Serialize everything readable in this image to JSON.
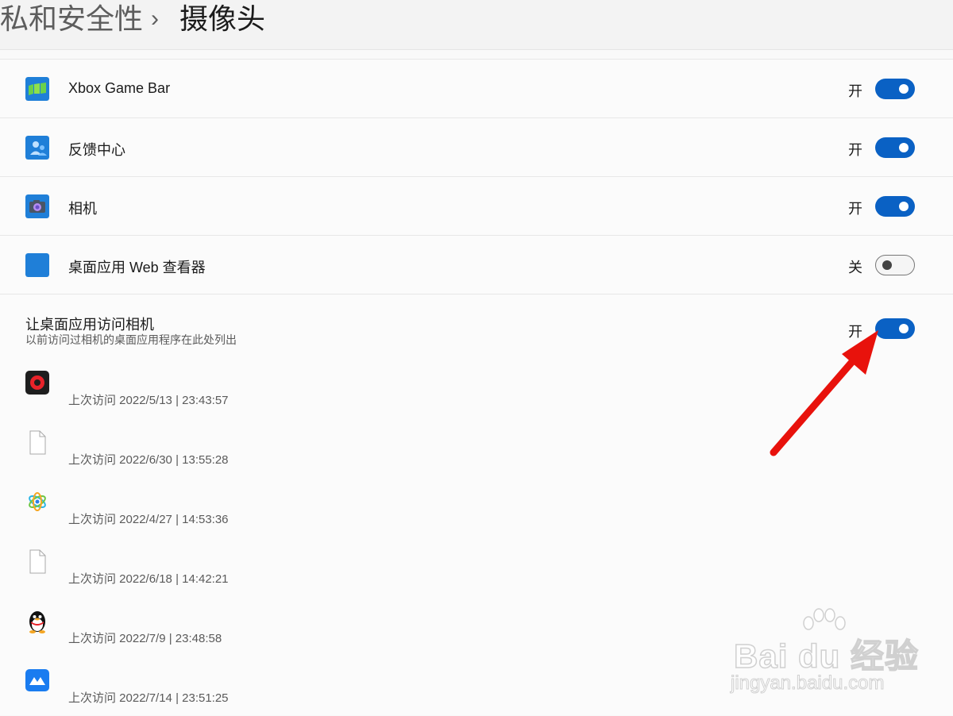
{
  "header": {
    "parent": "私和安全性",
    "separator": "›",
    "current": "摄像头"
  },
  "apps": [
    {
      "name": "Xbox Game Bar",
      "state_label": "开",
      "on": true,
      "icon": "xbox-game-bar-icon",
      "icon_color": "#1f7fd8"
    },
    {
      "name": "反馈中心",
      "state_label": "开",
      "on": true,
      "icon": "feedback-hub-icon",
      "icon_color": "#1f7fd8"
    },
    {
      "name": "相机",
      "state_label": "开",
      "on": true,
      "icon": "camera-icon",
      "icon_color": "#1f7fd8"
    },
    {
      "name": "桌面应用 Web 查看器",
      "state_label": "关",
      "on": false,
      "icon": "web-viewer-icon",
      "icon_color": "#1f7fd8"
    }
  ],
  "desktop_access": {
    "title": "让桌面应用访问相机",
    "subtitle": "以前访问过相机的桌面应用程序在此处列出",
    "state_label": "开",
    "on": true,
    "items": [
      {
        "text": "上次访问 2022/5/13  |  23:43:57",
        "icon": "screen-recorder-icon"
      },
      {
        "text": "上次访问 2022/6/30  |  13:55:28",
        "icon": "generic-file-icon"
      },
      {
        "text": "上次访问 2022/4/27  |  14:53:36",
        "icon": "colorful-swirl-app-icon"
      },
      {
        "text": "上次访问 2022/6/18  |  14:42:21",
        "icon": "generic-file-icon"
      },
      {
        "text": "上次访问 2022/7/9  |  23:48:58",
        "icon": "qq-penguin-icon"
      },
      {
        "text": "上次访问 2022/7/14  |  23:51:25",
        "icon": "blue-meeting-app-icon"
      }
    ]
  },
  "colors": {
    "toggle_on": "#0a61c4",
    "annotation_arrow": "#e8120c"
  },
  "watermark": {
    "brand": "Bai du 经验",
    "url": "jingyan.baidu.com"
  }
}
